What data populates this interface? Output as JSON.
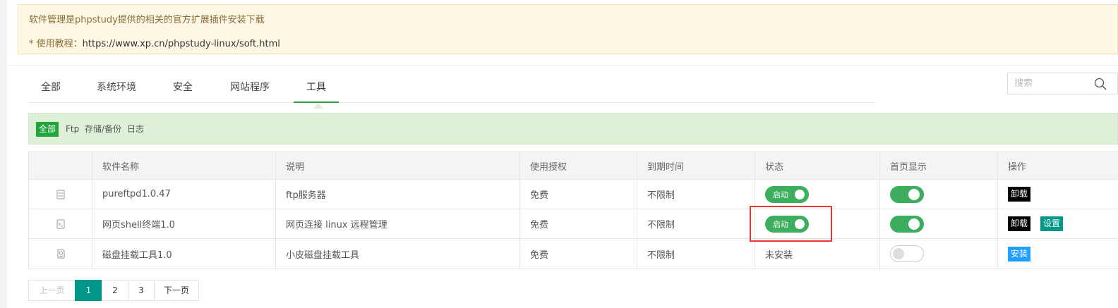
{
  "notice": {
    "line1": "软件管理是phpstudy提供的相关的官方扩展插件安装下载",
    "line2_prefix": "* 使用教程：",
    "line2_link": "https://www.xp.cn/phpstudy-linux/soft.html"
  },
  "tabs": [
    {
      "label": "全部",
      "active": false
    },
    {
      "label": "系统环境",
      "active": false
    },
    {
      "label": "安全",
      "active": false
    },
    {
      "label": "网站程序",
      "active": false
    },
    {
      "label": "工具",
      "active": true
    }
  ],
  "search": {
    "placeholder": "搜索"
  },
  "filters": [
    {
      "label": "全部",
      "active": true
    },
    {
      "label": "Ftp",
      "active": false
    },
    {
      "label": "存储/备份",
      "active": false
    },
    {
      "label": "日志",
      "active": false
    }
  ],
  "table": {
    "headers": [
      "",
      "软件名称",
      "说明",
      "使用授权",
      "到期时间",
      "状态",
      "首页显示",
      "操作"
    ],
    "rows": [
      {
        "icon": "ftp-server-icon",
        "name": "pureftpd1.0.47",
        "desc": "ftp服务器",
        "license": "免费",
        "expire": "不限制",
        "status_label": "启动",
        "status": "running",
        "home_display": true,
        "actions": [
          "卸载"
        ]
      },
      {
        "icon": "web-shell-icon",
        "name": "网页shell终端1.0",
        "desc": "网页连接 linux 远程管理",
        "license": "免费",
        "expire": "不限制",
        "status_label": "启动",
        "status": "running",
        "home_display": true,
        "actions": [
          "卸载",
          "设置"
        ]
      },
      {
        "icon": "disk-mount-icon",
        "name": "磁盘挂载工具1.0",
        "desc": "小皮磁盘挂载工具",
        "license": "免费",
        "expire": "不限制",
        "status_label": "未安装",
        "status": "not-installed",
        "home_display": false,
        "actions": [
          "安装"
        ]
      }
    ]
  },
  "pagination": {
    "prev": "上一页",
    "pages": [
      "1",
      "2",
      "3"
    ],
    "current": "1",
    "next": "下一页"
  },
  "colors": {
    "green": "#20a53a",
    "switch_green": "#3cae5e",
    "teal": "#009688",
    "blue": "#1e9fff",
    "highlight_red": "#e53935"
  }
}
